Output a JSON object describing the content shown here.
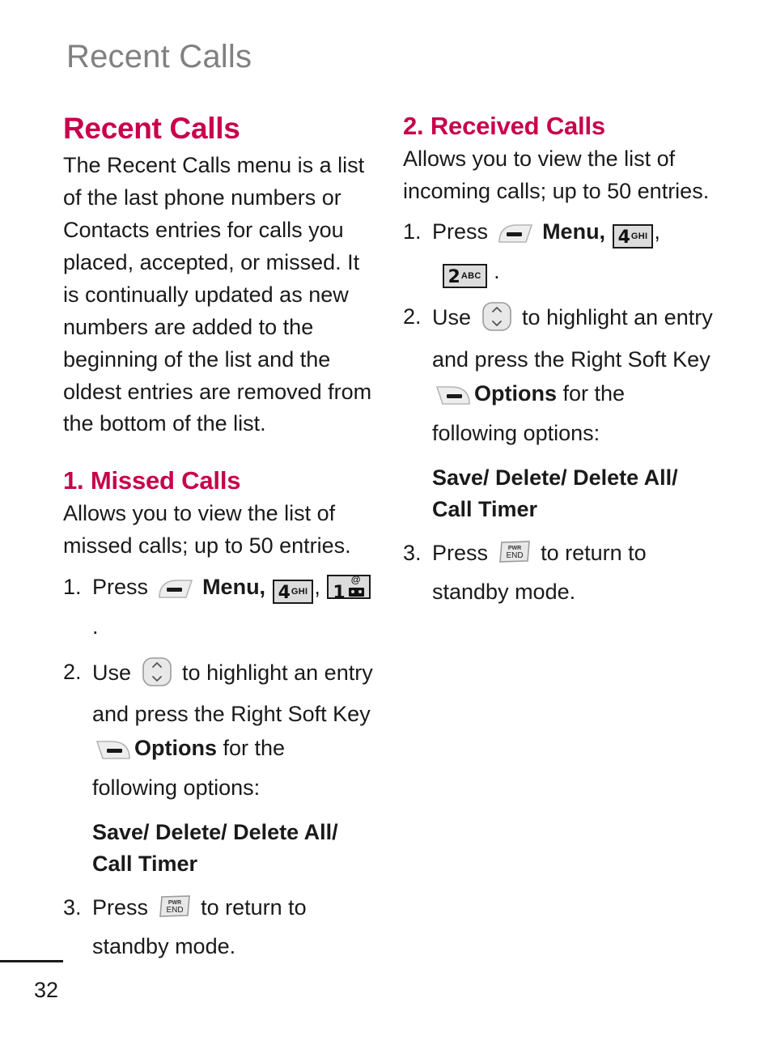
{
  "page": {
    "running_head": "Recent Calls",
    "folio": "32",
    "accent_color": "#C8004B",
    "running_head_color": "#808080",
    "text_color": "#1A1A1A"
  },
  "left_column": {
    "heading": "Recent Calls",
    "intro": "The Recent Calls menu is a list of the last phone numbers or Contacts entries for calls you placed, accepted, or missed. It is continually updated as new numbers are added to the beginning of the list and the oldest entries are removed from the bottom of the list.",
    "subsection": {
      "heading": "1. Missed Calls",
      "intro": "Allows you to view the list of missed calls; up to 50 entries.",
      "steps": [
        {
          "num": "1.",
          "pre": "Press",
          "key_left_soft": "left-soft-key",
          "menu_label": "Menu,",
          "key_4": {
            "digit": "4",
            "letters": "GHI"
          },
          "comma": ",",
          "key_1": {
            "digit": "1",
            "letters": "voicemail"
          },
          "period": "."
        },
        {
          "num": "2.",
          "pre": "Use",
          "key_nav": "navigation-key",
          "mid": "to highlight an entry and press the Right Soft Key",
          "key_right_soft": "right-soft-key",
          "options_label": "Options",
          "post": "for the following options:"
        },
        {
          "num": "3.",
          "pre": "Press",
          "key_end": {
            "top": "PWR",
            "bottom": "END"
          },
          "post": "to return to standby mode."
        }
      ],
      "options_text": "Save/ Delete/ Delete All/ Call Timer"
    }
  },
  "right_column": {
    "subsection": {
      "heading": "2. Received Calls",
      "intro": "Allows you to view the list of incoming calls; up to 50 entries.",
      "steps": [
        {
          "num": "1.",
          "pre": "Press",
          "key_left_soft": "left-soft-key",
          "menu_label": "Menu,",
          "key_4": {
            "digit": "4",
            "letters": "GHI"
          },
          "comma": ",",
          "key_2": {
            "digit": "2",
            "letters": "ABC"
          },
          "period": "."
        },
        {
          "num": "2.",
          "pre": "Use",
          "key_nav": "navigation-key",
          "mid": "to highlight an entry and press the Right Soft Key",
          "key_right_soft": "right-soft-key",
          "options_label": "Options",
          "post": "for the following options:"
        },
        {
          "num": "3.",
          "pre": "Press",
          "key_end": {
            "top": "PWR",
            "bottom": "END"
          },
          "post": "to return to standby mode."
        }
      ],
      "options_text": "Save/ Delete/ Delete All/ Call Timer"
    }
  }
}
